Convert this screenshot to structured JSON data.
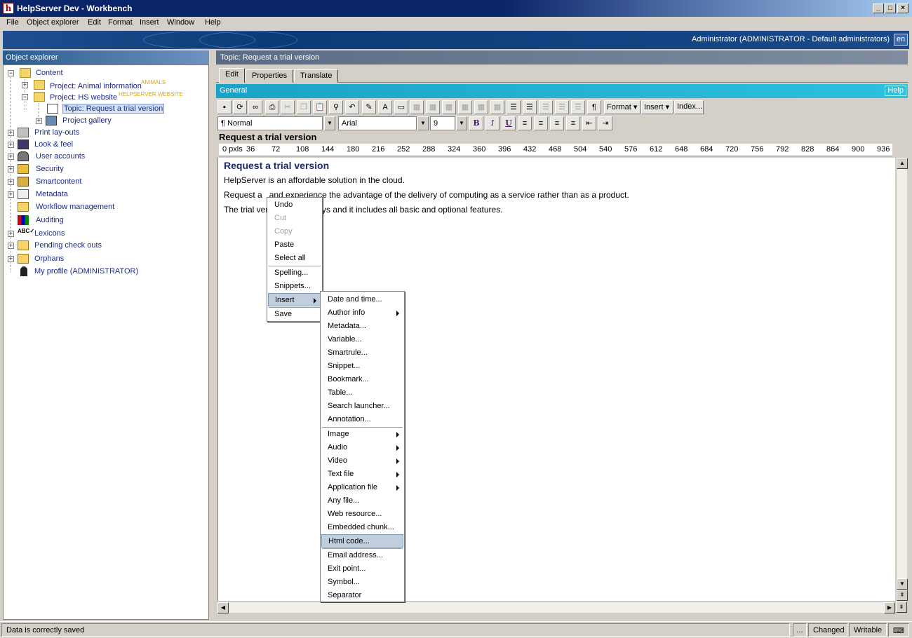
{
  "window": {
    "title": "HelpServer Dev - Workbench",
    "app_icon": "h"
  },
  "menubar": [
    "File",
    "Object explorer",
    "Edit",
    "Format",
    "Insert",
    "Window",
    "Help"
  ],
  "banner": {
    "user": "Administrator (ADMINISTRATOR - Default administrators)",
    "lang": "en"
  },
  "left": {
    "header": "Object explorer",
    "tree": {
      "content": "Content",
      "animal": "Project: Animal information",
      "animal_badge": "ANIMALS",
      "hs": "Project: HS website",
      "hs_badge": "HELPSERVER WEBSITE",
      "topic": "Topic: Request a trial version",
      "gallery": "Project gallery",
      "print": "Print lay-outs",
      "look": "Look & feel",
      "users": "User accounts",
      "security": "Security",
      "smart": "Smartcontent",
      "meta": "Metadata",
      "workflow": "Workflow management",
      "audit": "Auditing",
      "lex": "Lexicons",
      "pending": "Pending check outs",
      "orphans": "Orphans",
      "profile": "My profile (ADMINISTRATOR)"
    }
  },
  "right": {
    "header": "Topic: Request a trial version",
    "tabs": [
      "Edit",
      "Properties",
      "Translate"
    ],
    "general": "General",
    "help": "Help",
    "toolbar": {
      "format": "Format",
      "insert": "Insert",
      "index": "Index...",
      "pilcrow": "¶"
    },
    "formatbar": {
      "style": "Normal",
      "font": "Arial",
      "size": "9",
      "bold": "B",
      "italic": "I",
      "underline": "U"
    },
    "doc_title": "Request a trial version",
    "ruler": [
      "0 pxls",
      "36",
      "72",
      "108",
      "144",
      "180",
      "216",
      "252",
      "288",
      "324",
      "360",
      "396",
      "432",
      "468",
      "504",
      "540",
      "576",
      "612",
      "648",
      "684",
      "720",
      "756",
      "792",
      "828",
      "864",
      "900",
      "936"
    ],
    "editor": {
      "heading": "Request a trial version",
      "p1": "HelpServer is an affordable solution in the cloud.",
      "p2a": "Request a",
      "p2b": "and experience the advantage of the delivery of computing as a service rather than as a product.",
      "p3a": "The trial ver",
      "p3b": "ays and it includes all basic and optional features."
    }
  },
  "context_menu": {
    "undo": "Undo",
    "cut": "Cut",
    "copy": "Copy",
    "paste": "Paste",
    "select_all": "Select all",
    "spelling": "Spelling...",
    "snippets": "Snippets...",
    "insert": "Insert",
    "save": "Save"
  },
  "submenu": {
    "items1": [
      "Date and time...",
      "Author info",
      "Metadata...",
      "Variable...",
      "Smartrule...",
      "Snippet...",
      "Bookmark...",
      "Table...",
      "Search launcher...",
      "Annotation..."
    ],
    "items2": [
      "Image",
      "Audio",
      "Video",
      "Text file",
      "Application file",
      "Any file...",
      "Web resource...",
      "Embedded chunk...",
      "Html code..."
    ],
    "items3": [
      "Email address...",
      "Exit point...",
      "Symbol...",
      "Separator"
    ]
  },
  "status": {
    "message": "Data is correctly saved",
    "dots": "...",
    "changed": "Changed",
    "writable": "Writable"
  },
  "colors": {
    "title_bar": "#0a246a",
    "banner": "#0b3a78",
    "general_bar": "#1aa3c8",
    "highlight": "#c2cede"
  }
}
